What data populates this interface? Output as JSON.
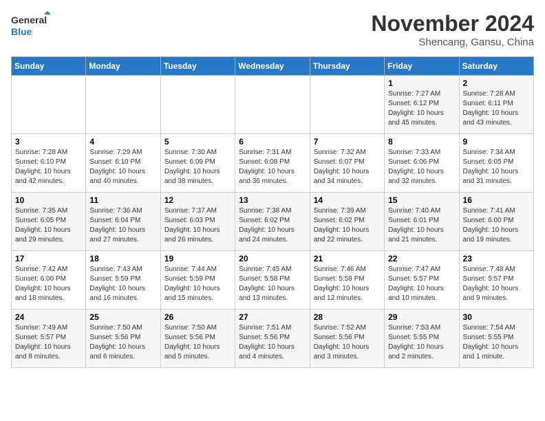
{
  "header": {
    "logo_line1": "General",
    "logo_line2": "Blue",
    "month": "November 2024",
    "location": "Shencang, Gansu, China"
  },
  "weekdays": [
    "Sunday",
    "Monday",
    "Tuesday",
    "Wednesday",
    "Thursday",
    "Friday",
    "Saturday"
  ],
  "weeks": [
    [
      {
        "day": "",
        "info": ""
      },
      {
        "day": "",
        "info": ""
      },
      {
        "day": "",
        "info": ""
      },
      {
        "day": "",
        "info": ""
      },
      {
        "day": "",
        "info": ""
      },
      {
        "day": "1",
        "info": "Sunrise: 7:27 AM\nSunset: 6:12 PM\nDaylight: 10 hours\nand 45 minutes."
      },
      {
        "day": "2",
        "info": "Sunrise: 7:28 AM\nSunset: 6:11 PM\nDaylight: 10 hours\nand 43 minutes."
      }
    ],
    [
      {
        "day": "3",
        "info": "Sunrise: 7:28 AM\nSunset: 6:10 PM\nDaylight: 10 hours\nand 42 minutes."
      },
      {
        "day": "4",
        "info": "Sunrise: 7:29 AM\nSunset: 6:10 PM\nDaylight: 10 hours\nand 40 minutes."
      },
      {
        "day": "5",
        "info": "Sunrise: 7:30 AM\nSunset: 6:09 PM\nDaylight: 10 hours\nand 38 minutes."
      },
      {
        "day": "6",
        "info": "Sunrise: 7:31 AM\nSunset: 6:08 PM\nDaylight: 10 hours\nand 36 minutes."
      },
      {
        "day": "7",
        "info": "Sunrise: 7:32 AM\nSunset: 6:07 PM\nDaylight: 10 hours\nand 34 minutes."
      },
      {
        "day": "8",
        "info": "Sunrise: 7:33 AM\nSunset: 6:06 PM\nDaylight: 10 hours\nand 32 minutes."
      },
      {
        "day": "9",
        "info": "Sunrise: 7:34 AM\nSunset: 6:05 PM\nDaylight: 10 hours\nand 31 minutes."
      }
    ],
    [
      {
        "day": "10",
        "info": "Sunrise: 7:35 AM\nSunset: 6:05 PM\nDaylight: 10 hours\nand 29 minutes."
      },
      {
        "day": "11",
        "info": "Sunrise: 7:36 AM\nSunset: 6:04 PM\nDaylight: 10 hours\nand 27 minutes."
      },
      {
        "day": "12",
        "info": "Sunrise: 7:37 AM\nSunset: 6:03 PM\nDaylight: 10 hours\nand 26 minutes."
      },
      {
        "day": "13",
        "info": "Sunrise: 7:38 AM\nSunset: 6:02 PM\nDaylight: 10 hours\nand 24 minutes."
      },
      {
        "day": "14",
        "info": "Sunrise: 7:39 AM\nSunset: 6:02 PM\nDaylight: 10 hours\nand 22 minutes."
      },
      {
        "day": "15",
        "info": "Sunrise: 7:40 AM\nSunset: 6:01 PM\nDaylight: 10 hours\nand 21 minutes."
      },
      {
        "day": "16",
        "info": "Sunrise: 7:41 AM\nSunset: 6:00 PM\nDaylight: 10 hours\nand 19 minutes."
      }
    ],
    [
      {
        "day": "17",
        "info": "Sunrise: 7:42 AM\nSunset: 6:00 PM\nDaylight: 10 hours\nand 18 minutes."
      },
      {
        "day": "18",
        "info": "Sunrise: 7:43 AM\nSunset: 5:59 PM\nDaylight: 10 hours\nand 16 minutes."
      },
      {
        "day": "19",
        "info": "Sunrise: 7:44 AM\nSunset: 5:59 PM\nDaylight: 10 hours\nand 15 minutes."
      },
      {
        "day": "20",
        "info": "Sunrise: 7:45 AM\nSunset: 5:58 PM\nDaylight: 10 hours\nand 13 minutes."
      },
      {
        "day": "21",
        "info": "Sunrise: 7:46 AM\nSunset: 5:58 PM\nDaylight: 10 hours\nand 12 minutes."
      },
      {
        "day": "22",
        "info": "Sunrise: 7:47 AM\nSunset: 5:57 PM\nDaylight: 10 hours\nand 10 minutes."
      },
      {
        "day": "23",
        "info": "Sunrise: 7:48 AM\nSunset: 5:57 PM\nDaylight: 10 hours\nand 9 minutes."
      }
    ],
    [
      {
        "day": "24",
        "info": "Sunrise: 7:49 AM\nSunset: 5:57 PM\nDaylight: 10 hours\nand 8 minutes."
      },
      {
        "day": "25",
        "info": "Sunrise: 7:50 AM\nSunset: 5:56 PM\nDaylight: 10 hours\nand 6 minutes."
      },
      {
        "day": "26",
        "info": "Sunrise: 7:50 AM\nSunset: 5:56 PM\nDaylight: 10 hours\nand 5 minutes."
      },
      {
        "day": "27",
        "info": "Sunrise: 7:51 AM\nSunset: 5:56 PM\nDaylight: 10 hours\nand 4 minutes."
      },
      {
        "day": "28",
        "info": "Sunrise: 7:52 AM\nSunset: 5:56 PM\nDaylight: 10 hours\nand 3 minutes."
      },
      {
        "day": "29",
        "info": "Sunrise: 7:53 AM\nSunset: 5:55 PM\nDaylight: 10 hours\nand 2 minutes."
      },
      {
        "day": "30",
        "info": "Sunrise: 7:54 AM\nSunset: 5:55 PM\nDaylight: 10 hours\nand 1 minute."
      }
    ]
  ]
}
